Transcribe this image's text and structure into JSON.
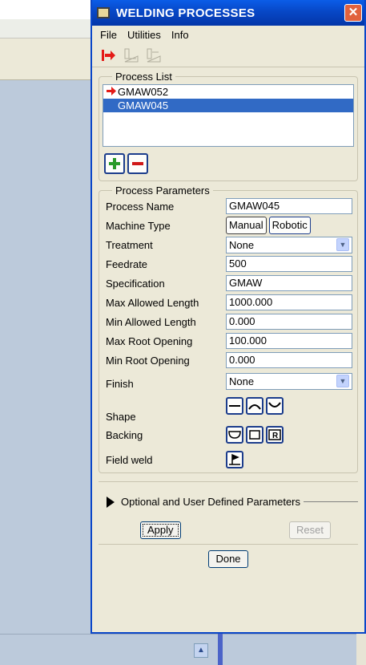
{
  "dialog": {
    "title": "WELDING PROCESSES",
    "close_label": "✕",
    "menu": [
      "File",
      "Utilities",
      "Info"
    ],
    "process_list_legend": "Process List",
    "processes": [
      {
        "name": "GMAW052",
        "active": true,
        "selected": false
      },
      {
        "name": "GMAW045",
        "active": false,
        "selected": true
      }
    ],
    "params_legend": "Process Parameters",
    "params": {
      "process_name_label": "Process Name",
      "process_name_value": "GMAW045",
      "machine_type_label": "Machine Type",
      "machine_manual": "Manual",
      "machine_robotic": "Robotic",
      "treatment_label": "Treatment",
      "treatment_value": "None",
      "feedrate_label": "Feedrate",
      "feedrate_value": "500",
      "specification_label": "Specification",
      "specification_value": "GMAW",
      "max_len_label": "Max Allowed Length",
      "max_len_value": "1000.000",
      "min_len_label": "Min Allowed Length",
      "min_len_value": "0.000",
      "max_root_label": "Max Root Opening",
      "max_root_value": "100.000",
      "min_root_label": "Min Root Opening",
      "min_root_value": "0.000",
      "finish_label": "Finish",
      "finish_value": "None",
      "shape_label": "Shape",
      "backing_label": "Backing",
      "backing_r": "R",
      "field_weld_label": "Field weld"
    },
    "optional_label": "Optional and User Defined Parameters",
    "apply_label": "Apply",
    "reset_label": "Reset",
    "done_label": "Done"
  },
  "colors": {
    "title_bar": "#0747c6",
    "selection": "#316ac5",
    "arrow": "#e41b17"
  }
}
